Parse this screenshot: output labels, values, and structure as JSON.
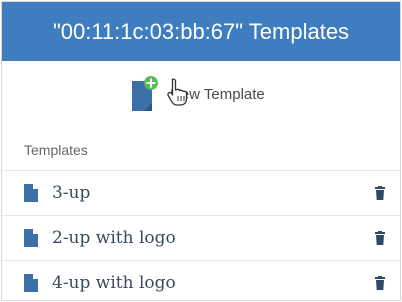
{
  "header": {
    "title": "\"00:11:1c:03:bb:67\" Templates"
  },
  "actions": {
    "new_template_label": "New Template"
  },
  "templates_section": {
    "label": "Templates",
    "items": [
      {
        "name": "3-up"
      },
      {
        "name": "2-up with logo"
      },
      {
        "name": "4-up with logo"
      }
    ]
  },
  "colors": {
    "header_bg": "#3d7dc0",
    "icon_blue": "#3d6fa8",
    "plus_green": "#5cb85c",
    "trash_gray": "#2e4a66"
  },
  "icons": {
    "new_template": "document-plus-icon",
    "template_item": "file-icon",
    "delete": "trash-icon",
    "cursor": "hand-pointer-icon"
  }
}
